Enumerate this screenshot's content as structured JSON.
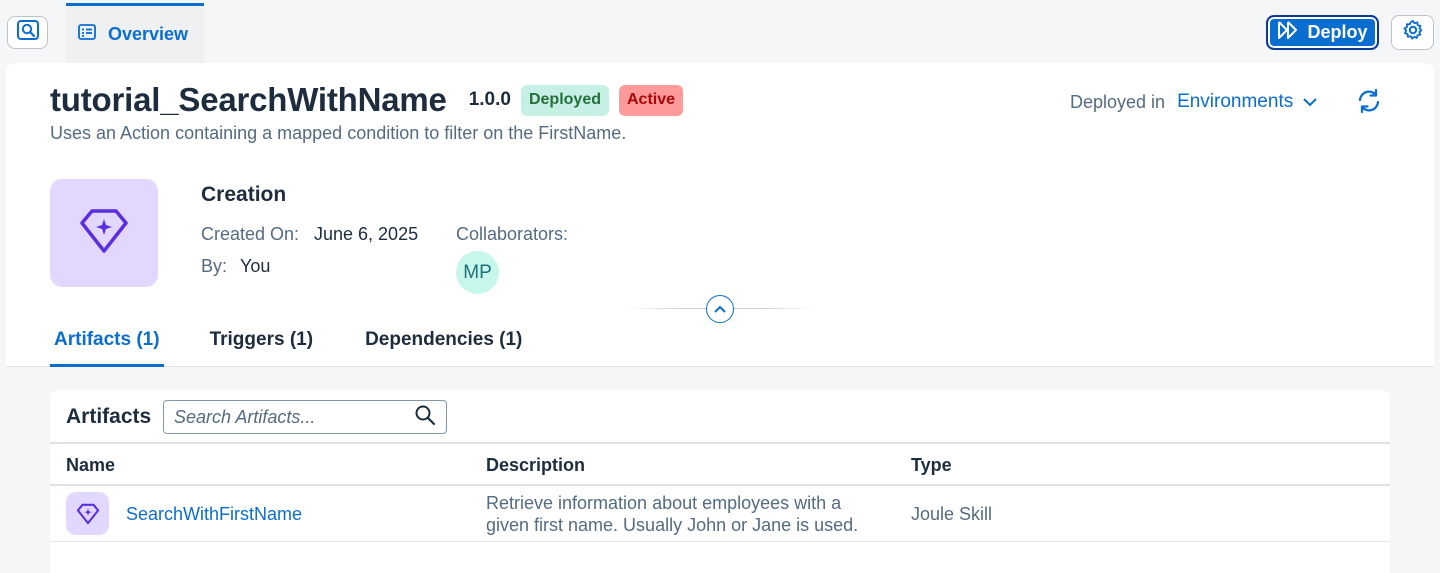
{
  "topbar": {
    "overview_tab_label": "Overview",
    "deploy_label": "Deploy"
  },
  "header": {
    "title": "tutorial_SearchWithName",
    "version": "1.0.0",
    "badge_deployed": "Deployed",
    "badge_active": "Active",
    "subtitle": "Uses an Action containing a mapped condition to filter on the FirstName.",
    "deployed_in_label": "Deployed in",
    "environments_label": "Environments"
  },
  "creation": {
    "title": "Creation",
    "created_on_label": "Created On:",
    "created_on_value": "June 6, 2025",
    "by_label": "By:",
    "by_value": "You",
    "collaborators_label": "Collaborators:",
    "collaborator_initials": "MP"
  },
  "tabs": [
    {
      "label": "Artifacts (1)",
      "selected": true
    },
    {
      "label": "Triggers (1)",
      "selected": false
    },
    {
      "label": "Dependencies (1)",
      "selected": false
    }
  ],
  "artifacts": {
    "title": "Artifacts",
    "search_placeholder": "Search Artifacts...",
    "columns": [
      "Name",
      "Description",
      "Type"
    ],
    "rows": [
      {
        "name": "SearchWithFirstName",
        "description": "Retrieve information about employees with a given first name. Usually John or Jane is used.",
        "type": "Joule Skill"
      }
    ]
  },
  "colors": {
    "accent": "#0a6ed1",
    "deployed_badge_bg": "#c6f0e5",
    "active_badge_bg": "#ff9a9a",
    "skill_icon_bg": "#e2d8ff",
    "skill_icon_fg": "#5b2ee0"
  }
}
